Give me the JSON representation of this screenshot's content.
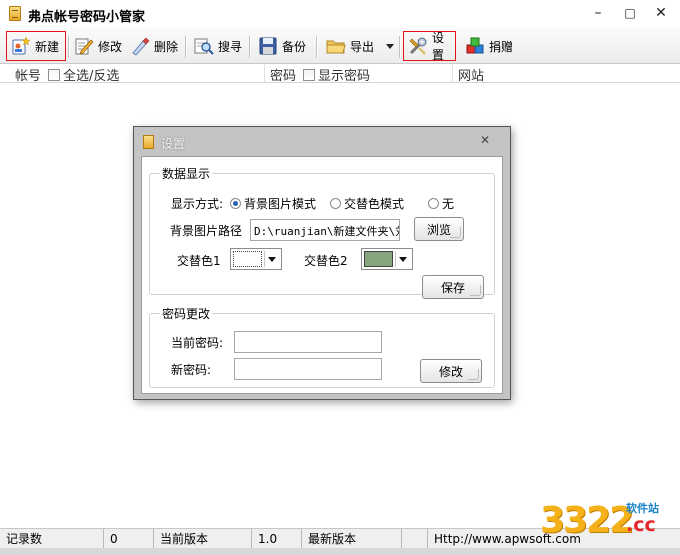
{
  "window": {
    "title": "弗点帐号密码小管家",
    "controls": {
      "minimize": "–",
      "maximize": "□",
      "close": "✕"
    }
  },
  "toolbar": {
    "new_label": "新建",
    "edit_label": "修改",
    "delete_label": "删除",
    "search_label": "搜寻",
    "backup_label": "备份",
    "export_label": "导出",
    "settings_label": "设置",
    "donate_label": "捐赠"
  },
  "list_header": {
    "account_label": "帐号",
    "select_all_label": "全选/反选",
    "password_label": "密码",
    "show_password_label": "显示密码",
    "website_label": "网站"
  },
  "settings_dialog": {
    "title": "设置",
    "close_glyph": "✕",
    "display_group": {
      "title": "数据显示",
      "mode_label": "显示方式:",
      "modes": [
        "背景图片模式",
        "交替色模式",
        "无"
      ],
      "selected_mode": "背景图片模式",
      "bg_path_label": "背景图片路径",
      "bg_path_value": "D:\\ruanjian\\新建文件夹\\刘",
      "browse_label": "浏览",
      "alt_color1_label": "交替色1",
      "alt_color1": "#ffffff",
      "alt_color2_label": "交替色2",
      "alt_color2": "#86a57e",
      "save_label": "保存"
    },
    "password_group": {
      "title": "密码更改",
      "current_label": "当前密码:",
      "current_value": "",
      "new_label": "新密码:",
      "new_value": "",
      "change_label": "修改"
    }
  },
  "statusbar": {
    "record_count_label": "记录数",
    "record_count_value": "0",
    "current_version_label": "当前版本",
    "current_version_value": "1.0",
    "latest_version_label": "最新版本",
    "latest_version_value": "",
    "website_text": "Http://www.apwsoft.com"
  },
  "watermark": {
    "number": "3322",
    "site_text": "软件站",
    "tld": ".cc"
  },
  "colors": {
    "highlight_border": "#e0161b",
    "dialog_frame": "#c4c4c4"
  }
}
